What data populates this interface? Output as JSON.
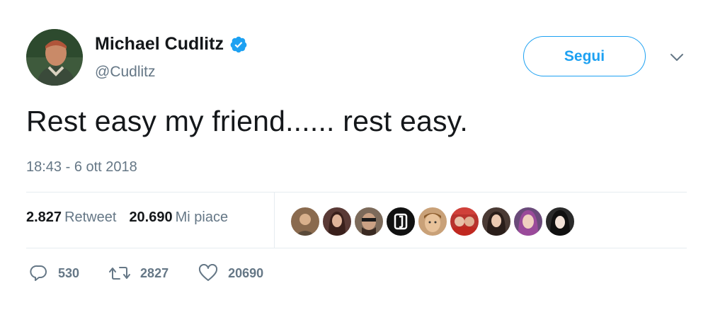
{
  "user": {
    "display_name": "Michael Cudlitz",
    "handle": "@Cudlitz",
    "verified_icon": "verified-badge-icon",
    "avatar_icon": "profile-photo"
  },
  "follow_button": {
    "label": "Segui"
  },
  "menu": {
    "icon": "chevron-down-icon"
  },
  "tweet": {
    "text": "Rest easy my friend...... rest easy.",
    "timestamp": "18:43 - 6 ott 2018"
  },
  "stats": {
    "retweets_count": "2.827",
    "retweets_label": "Retweet",
    "likes_count": "20.690",
    "likes_label": "Mi piace"
  },
  "likers": [
    {
      "icon": "liker-avatar-1",
      "color": "#8a6a4e"
    },
    {
      "icon": "liker-avatar-2",
      "color": "#5a3a36"
    },
    {
      "icon": "liker-avatar-3",
      "color": "#7c6a5a"
    },
    {
      "icon": "liker-avatar-4",
      "color": "#111111"
    },
    {
      "icon": "liker-avatar-5",
      "color": "#c9a178"
    },
    {
      "icon": "liker-avatar-6",
      "color": "#b8342f"
    },
    {
      "icon": "liker-avatar-7",
      "color": "#4a3a34"
    },
    {
      "icon": "liker-avatar-8",
      "color": "#6a4a7a"
    },
    {
      "icon": "liker-avatar-9",
      "color": "#2a2a2a"
    }
  ],
  "actions": {
    "reply": {
      "icon": "reply-icon",
      "count": "530"
    },
    "retweet": {
      "icon": "retweet-icon",
      "count": "2827"
    },
    "like": {
      "icon": "heart-icon",
      "count": "20690"
    }
  },
  "colors": {
    "accent": "#1da1f2",
    "text_primary": "#14171a",
    "text_secondary": "#657786",
    "divider": "#e6ecf0"
  }
}
